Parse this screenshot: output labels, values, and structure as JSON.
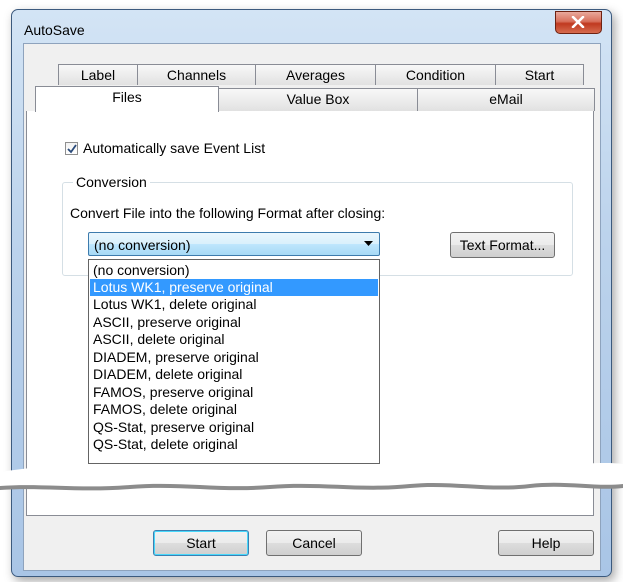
{
  "window": {
    "title": "AutoSave"
  },
  "tabs": {
    "row1": [
      "Label",
      "Channels",
      "Averages",
      "Condition",
      "Start"
    ],
    "row2": [
      "Files",
      "Value Box",
      "eMail"
    ],
    "active": "Files"
  },
  "files_page": {
    "autosave_checkbox": {
      "label": "Automatically save Event List",
      "checked": true
    },
    "conversion_group": {
      "title": "Conversion",
      "prompt": "Convert File into the following Format after closing:",
      "combo_value": "(no conversion)",
      "text_format_button": "Text Format...",
      "options": [
        "(no conversion)",
        "Lotus WK1, preserve original",
        "Lotus WK1, delete original",
        "ASCII, preserve original",
        "ASCII, delete original",
        "DIADEM, preserve original",
        "DIADEM, delete original",
        "FAMOS, preserve original",
        "FAMOS, delete original",
        "QS-Stat, preserve original",
        "QS-Stat, delete original"
      ],
      "highlighted_option": "Lotus WK1, preserve original"
    }
  },
  "buttons": {
    "start": "Start",
    "cancel": "Cancel",
    "help": "Help"
  }
}
